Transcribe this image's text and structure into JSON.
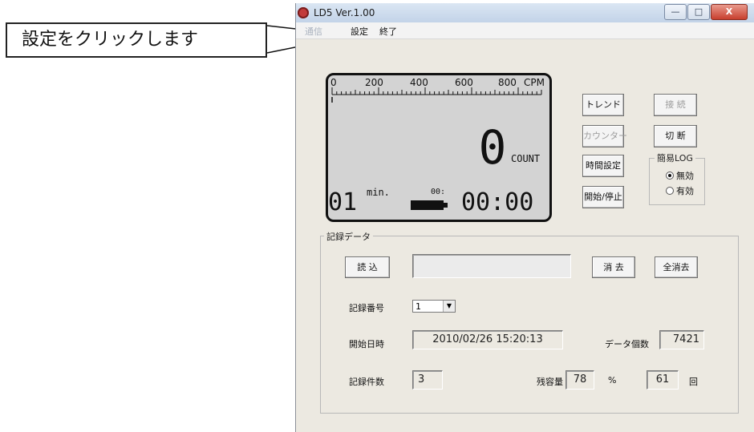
{
  "callout": {
    "text": "設定をクリックします"
  },
  "window": {
    "title": "LD5  Ver.1.00",
    "buttons": {
      "minimize": "—",
      "maximize": "□",
      "close": "X"
    }
  },
  "menu": {
    "item1": "通信",
    "item2": "設定",
    "item3": "終了"
  },
  "lcd": {
    "scale_ticks": [
      "0",
      "200",
      "400",
      "600",
      "800"
    ],
    "scale_unit": "CPM",
    "count_value": "0",
    "count_unit": "COUNT",
    "minutes_value": "01",
    "minutes_unit": "min.",
    "small_time": "00:",
    "time_value": "00:00"
  },
  "buttons": {
    "trend": "トレンド",
    "connect": "接 続",
    "counter": "カウンター",
    "disconnect": "切 断",
    "time_setting": "時間設定",
    "start_stop": "開始/停止"
  },
  "simple_log": {
    "title": "簡易LOG",
    "option_disabled": "無効",
    "option_enabled": "有効",
    "selected": "無効"
  },
  "record": {
    "group_title": "記録データ",
    "read_button": "読 込",
    "read_field": "",
    "delete_button": "消 去",
    "delete_all_button": "全消去",
    "number_label": "記録番号",
    "number_value": "1",
    "start_label": "開始日時",
    "start_value": "2010/02/26 15:20:13",
    "data_count_label": "データ個数",
    "data_count_value": "7421",
    "records_label": "記録件数",
    "records_value": "3",
    "remaining_label": "残容量",
    "remaining_value": "78",
    "percent_unit": "%",
    "times_value": "61",
    "times_unit": "回"
  }
}
